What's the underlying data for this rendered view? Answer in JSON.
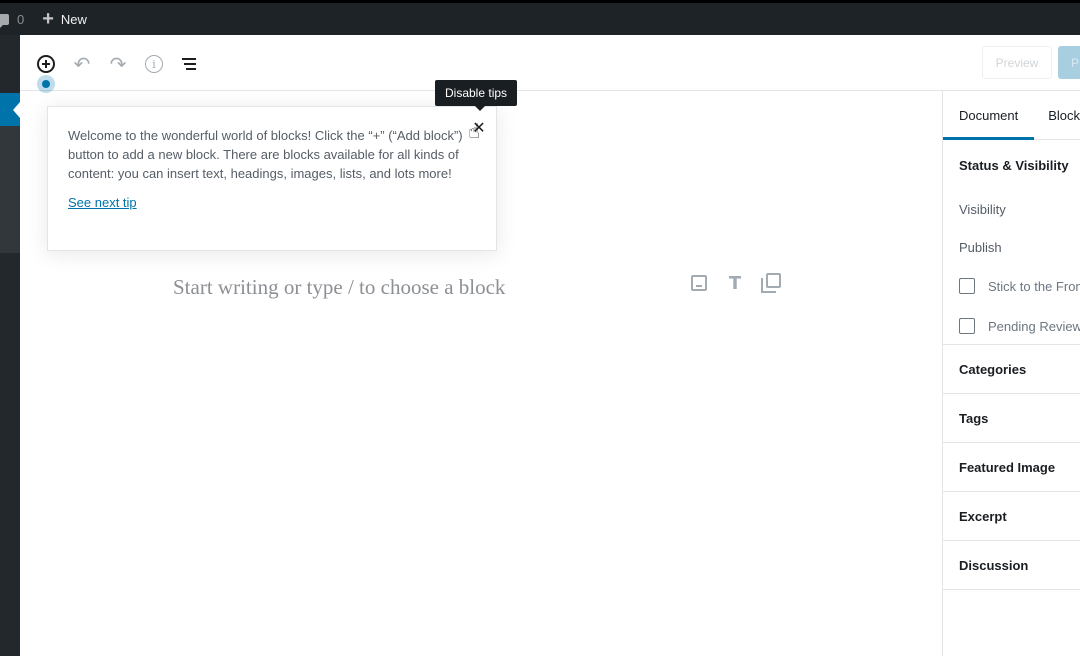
{
  "admin_bar": {
    "comment_count": "0",
    "new_label": "New"
  },
  "toolbar": {
    "add_block_icon": "plus-circle-icon",
    "undo_icon": "undo-icon",
    "redo_icon": "redo-icon",
    "info_icon": "info-icon",
    "outline_icon": "block-navigation-icon",
    "preview_label": "Preview",
    "publish_label": "P"
  },
  "tip": {
    "text": "Welcome to the wonderful world of blocks! Click the “+” (“Add block”) button to add a new block. There are blocks available for all kinds of content: you can insert text, headings, images, lists, and lots more!",
    "next_tip_label": "See next tip",
    "close_icon": "close-icon",
    "tooltip": "Disable tips"
  },
  "editor": {
    "placeholder": "Start writing or type / to choose a block",
    "inserter_icons": [
      "image-icon",
      "heading-icon",
      "gallery-icon"
    ]
  },
  "sidebar": {
    "tabs": [
      {
        "label": "Document",
        "active": true
      },
      {
        "label": "Block",
        "active": false
      }
    ],
    "status_panel": {
      "title": "Status & Visibility",
      "visibility_label": "Visibility",
      "publish_label": "Publish",
      "stick_to_front_label": "Stick to the Front Page",
      "pending_review_label": "Pending Review"
    },
    "panels": [
      {
        "title": "Categories"
      },
      {
        "title": "Tags"
      },
      {
        "title": "Featured Image"
      },
      {
        "title": "Excerpt"
      },
      {
        "title": "Discussion"
      }
    ]
  }
}
